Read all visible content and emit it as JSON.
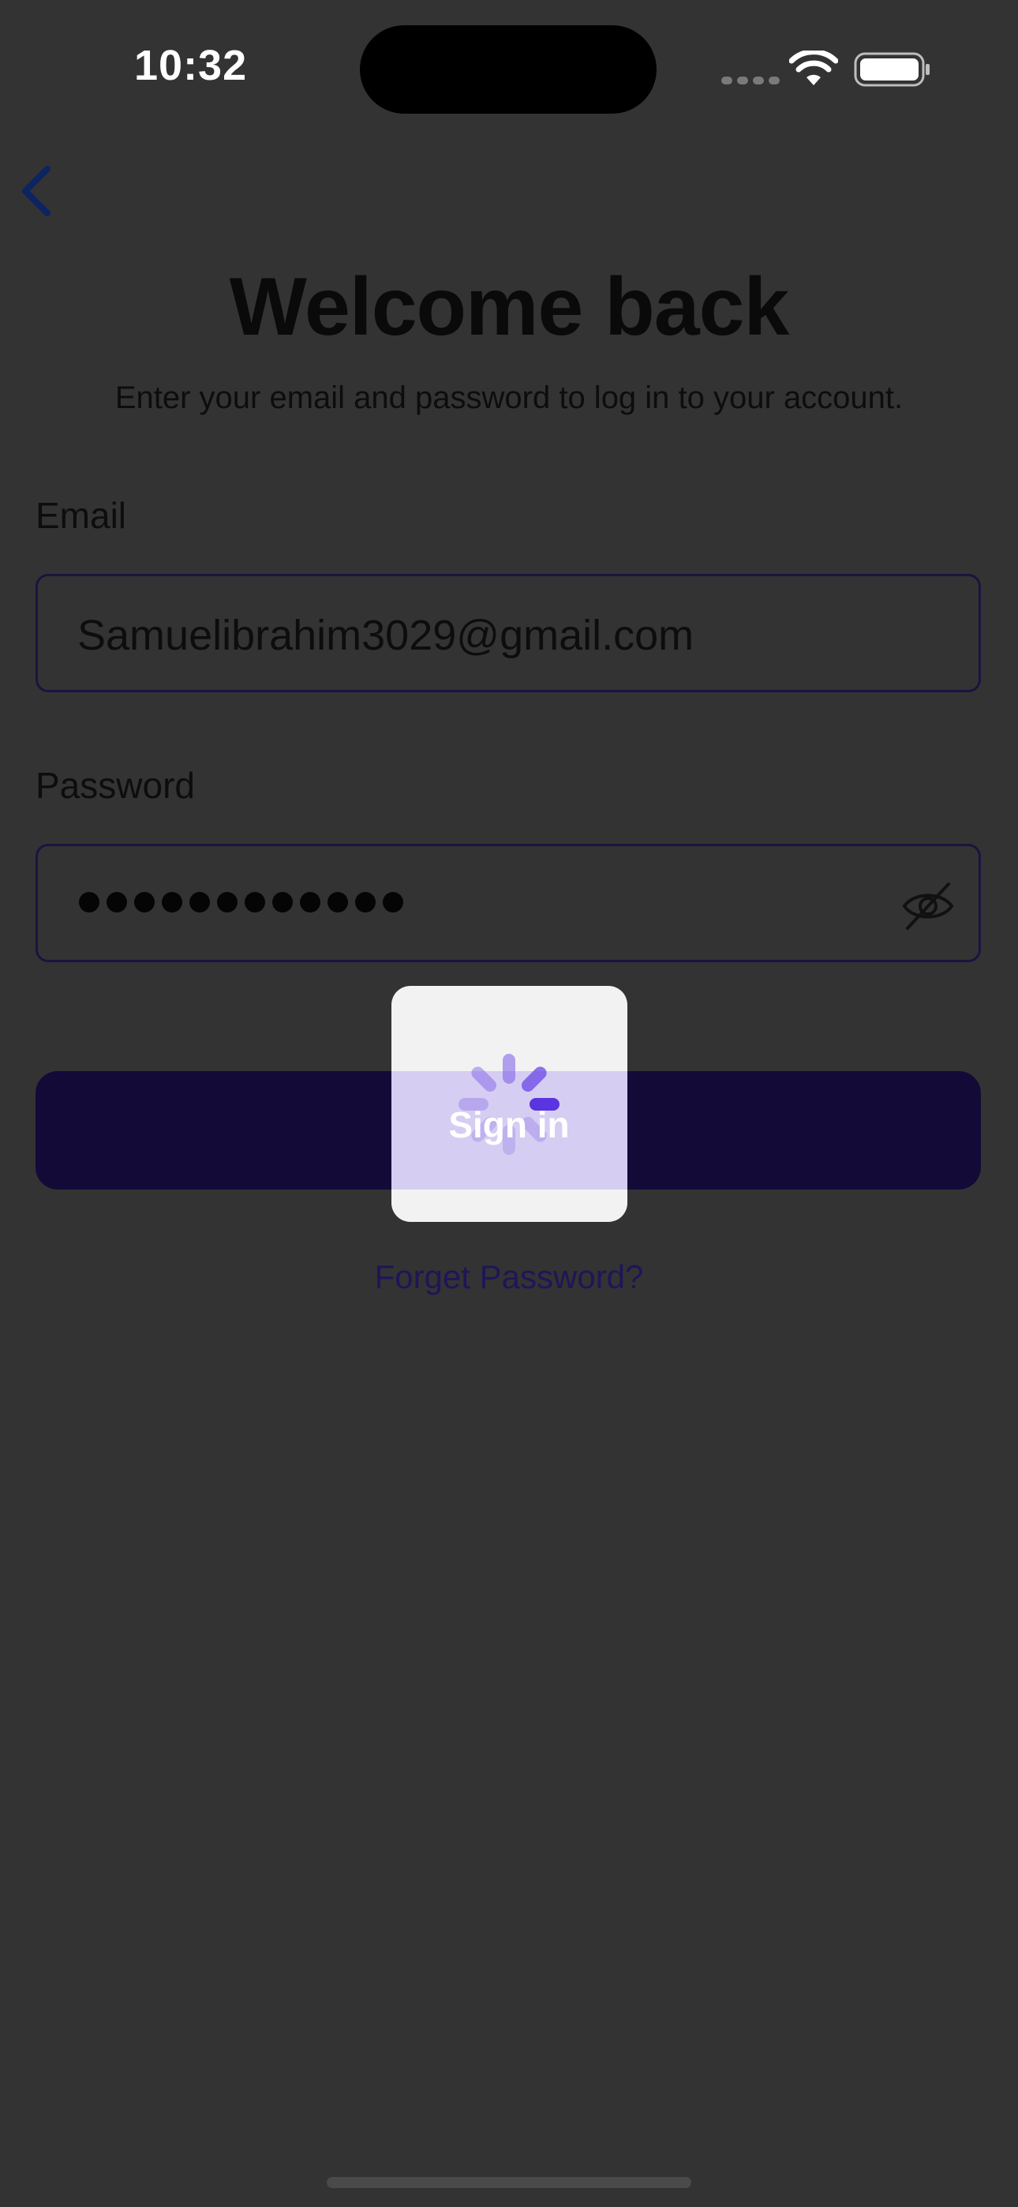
{
  "status_bar": {
    "time": "10:32"
  },
  "header": {
    "title": "Welcome back",
    "subtitle": "Enter your email and password to log in to your account."
  },
  "form": {
    "email_label": "Email",
    "email_value": "Samuelibrahim3029@gmail.com",
    "password_label": "Password",
    "password_mask_count": 12,
    "submit_label": "Sign in",
    "forgot_label": "Forget Password?"
  },
  "overlay": {
    "state": "loading"
  },
  "colors": {
    "background": "#333333",
    "primary": "#140a38",
    "accent": "#6c4ee6",
    "link": "#1e1658"
  }
}
